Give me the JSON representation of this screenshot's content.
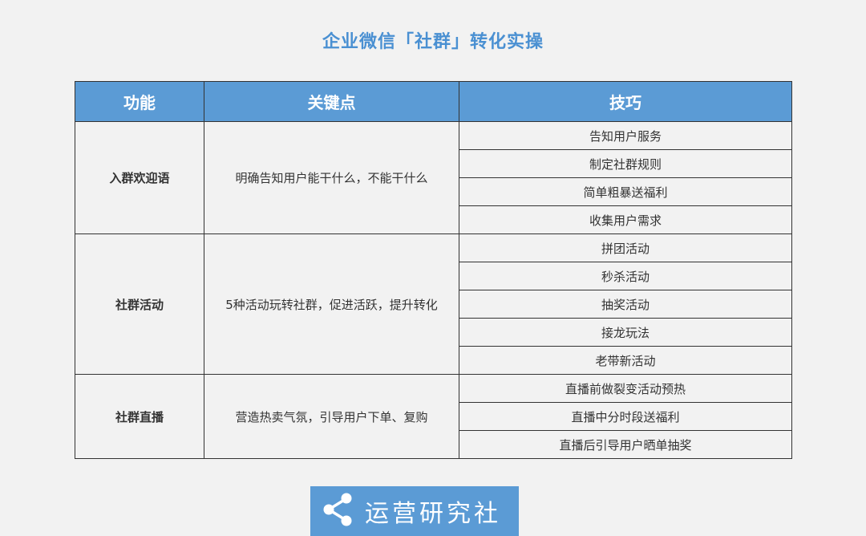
{
  "title": "企业微信「社群」转化实操",
  "table": {
    "headers": [
      "功能",
      "关键点",
      "技巧"
    ],
    "groups": [
      {
        "func": "入群欢迎语",
        "key": "明确告知用户能干什么，不能干什么",
        "tips": [
          "告知用户服务",
          "制定社群规则",
          "简单粗暴送福利",
          "收集用户需求"
        ]
      },
      {
        "func": "社群活动",
        "key": "5种活动玩转社群，促进活跃，提升转化",
        "tips": [
          "拼团活动",
          "秒杀活动",
          "抽奖活动",
          "接龙玩法",
          "老带新活动"
        ]
      },
      {
        "func": "社群直播",
        "key": "营造热卖气氛，引导用户下单、复购",
        "tips": [
          "直播前做裂变活动预热",
          "直播中分时段送福利",
          "直播后引导用户晒单抽奖"
        ]
      }
    ]
  },
  "logo": {
    "text": "运营研究社",
    "icon": "share-icon"
  },
  "colors": {
    "title": "#4a90d2",
    "header_bg": "#5b9bd5",
    "page_bg": "#f2f2f2",
    "border": "#333333"
  }
}
